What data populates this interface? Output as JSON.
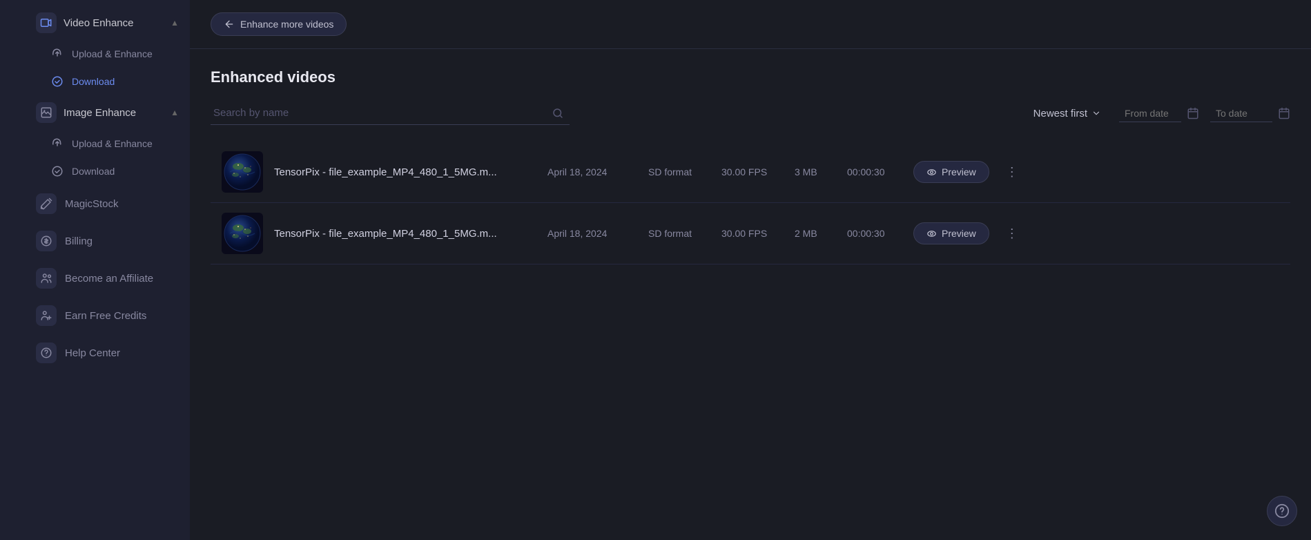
{
  "sidebar": {
    "sections": [
      {
        "id": "video-enhance",
        "label": "Video Enhance",
        "icon": "video",
        "expanded": true,
        "items": [
          {
            "id": "video-upload",
            "label": "Upload & Enhance",
            "icon": "cloud-upload",
            "active": false
          },
          {
            "id": "video-download",
            "label": "Download",
            "icon": "circle-check",
            "active": false
          }
        ]
      },
      {
        "id": "image-enhance",
        "label": "Image Enhance",
        "icon": "image",
        "expanded": true,
        "items": [
          {
            "id": "image-upload",
            "label": "Upload & Enhance",
            "icon": "cloud-upload",
            "active": false
          },
          {
            "id": "image-download",
            "label": "Download",
            "icon": "circle-check",
            "active": false
          }
        ]
      }
    ],
    "flat_items": [
      {
        "id": "magicstock",
        "label": "MagicStock",
        "icon": "wand"
      },
      {
        "id": "billing",
        "label": "Billing",
        "icon": "dollar"
      },
      {
        "id": "affiliate",
        "label": "Become an Affiliate",
        "icon": "users"
      },
      {
        "id": "credits",
        "label": "Earn Free Credits",
        "icon": "users-plus"
      },
      {
        "id": "help",
        "label": "Help Center",
        "icon": "question"
      }
    ]
  },
  "topbar": {
    "back_button_label": "Enhance more videos"
  },
  "content": {
    "page_title": "Enhanced videos",
    "search_placeholder": "Search by name",
    "sort_label": "Newest first",
    "from_date_placeholder": "From date",
    "to_date_placeholder": "To date",
    "videos": [
      {
        "id": 1,
        "name": "TensorPix - file_example_MP4_480_1_5MG.m...",
        "date": "April 18, 2024",
        "format": "SD format",
        "fps": "30.00 FPS",
        "size": "3 MB",
        "duration": "00:00:30",
        "preview_label": "Preview"
      },
      {
        "id": 2,
        "name": "TensorPix - file_example_MP4_480_1_5MG.m...",
        "date": "April 18, 2024",
        "format": "SD format",
        "fps": "30.00 FPS",
        "size": "2 MB",
        "duration": "00:00:30",
        "preview_label": "Preview"
      }
    ]
  },
  "colors": {
    "accent": "#6c8cf0",
    "bg_sidebar": "#1e2030",
    "bg_main": "#1a1c24"
  }
}
